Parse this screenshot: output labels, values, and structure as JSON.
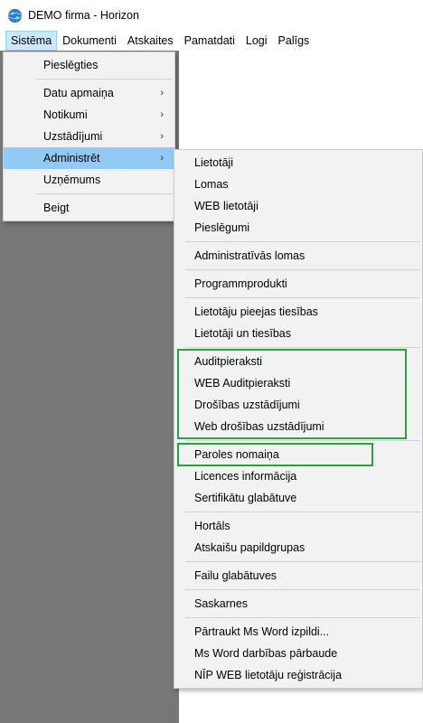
{
  "window": {
    "title": "DEMO firma - Horizon",
    "icon": "globe-icon"
  },
  "menubar": [
    {
      "name": "menu-sistema",
      "label": "Sistēma",
      "active": true
    },
    {
      "name": "menu-dokumenti",
      "label": "Dokumenti"
    },
    {
      "name": "menu-atskaites",
      "label": "Atskaites"
    },
    {
      "name": "menu-pamatdati",
      "label": "Pamatdati"
    },
    {
      "name": "menu-logi",
      "label": "Logi"
    },
    {
      "name": "menu-paligs",
      "label": "Palīgs"
    }
  ],
  "sistema_menu": [
    {
      "label": "Pieslēgties"
    },
    {
      "separator": true
    },
    {
      "label": "Datu apmaiņa",
      "submenu": true
    },
    {
      "label": "Notikumi",
      "submenu": true
    },
    {
      "label": "Uzstādījumi",
      "submenu": true
    },
    {
      "label": "Administrēt",
      "submenu": true,
      "highlighted": true
    },
    {
      "label": "Uzņēmums"
    },
    {
      "separator": true
    },
    {
      "label": "Beigt"
    }
  ],
  "administret_menu": [
    {
      "label": "Lietotāji"
    },
    {
      "label": "Lomas"
    },
    {
      "label": "WEB lietotāji"
    },
    {
      "label": "Pieslēgumi"
    },
    {
      "separator": true
    },
    {
      "label": "Administratīvās lomas"
    },
    {
      "separator": true
    },
    {
      "label": "Programmprodukti"
    },
    {
      "separator": true
    },
    {
      "label": "Lietotāju pieejas tiesības"
    },
    {
      "label": "Lietotāji un tiesības"
    },
    {
      "separator": true
    },
    {
      "label": "Auditpieraksti"
    },
    {
      "label": "WEB Auditpieraksti"
    },
    {
      "label": "Drošības uzstādījumi"
    },
    {
      "label": "Web drošības uzstādījumi"
    },
    {
      "separator": true
    },
    {
      "label": "Paroles nomaiņa"
    },
    {
      "label": "Licences informācija"
    },
    {
      "label": "Sertifikātu glabātuve"
    },
    {
      "separator": true
    },
    {
      "label": "Hortāls"
    },
    {
      "label": "Atskaišu papildgrupas"
    },
    {
      "separator": true
    },
    {
      "label": "Failu glabātuves"
    },
    {
      "separator": true
    },
    {
      "label": "Saskarnes"
    },
    {
      "separator": true
    },
    {
      "label": "Pārtraukt Ms Word izpildi..."
    },
    {
      "label": "Ms Word darbības pārbaude"
    },
    {
      "label": "NĪP WEB lietotāju reģistrācija"
    }
  ],
  "colors": {
    "highlight": "#91c9f7",
    "menubar_active": "#cce8ff",
    "workspace": "#777777",
    "annotation_box": "#26a243"
  }
}
